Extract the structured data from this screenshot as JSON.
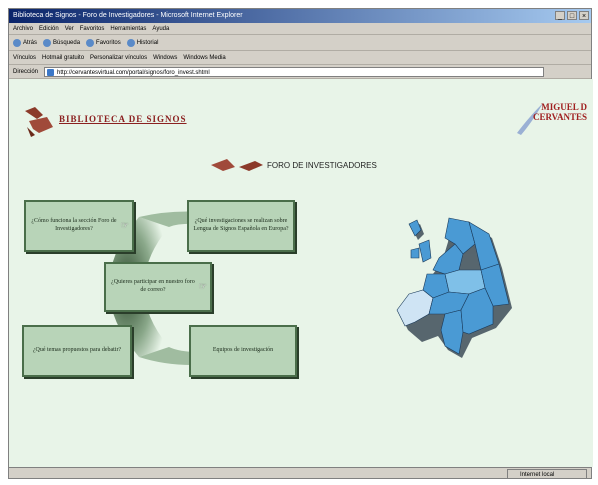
{
  "window": {
    "title": "Biblioteca de Signos - Foro de Investigadores - Microsoft Internet Explorer",
    "controls": [
      "_",
      "□",
      "×"
    ]
  },
  "menubar": {
    "items": [
      "Archivo",
      "Edición",
      "Ver",
      "Favoritos",
      "Herramientas",
      "Ayuda"
    ]
  },
  "toolbar": {
    "buttons": [
      "Atrás",
      "Búsqueda",
      "Favoritos",
      "Historial"
    ]
  },
  "linksbar": {
    "label": "Vínculos",
    "items": [
      "Hotmail gratuito",
      "Personalizar vínculos",
      "Windows",
      "Windows Media"
    ]
  },
  "addressbar": {
    "label": "Dirección",
    "value": "http://cervantesvirtual.com/portal/signos/foro_invest.shtml"
  },
  "page": {
    "site_title": "BIBLIOTECA DE SIGNOS",
    "logo_text_line1": "MIGUEL D",
    "logo_text_line2": "CERVANTES",
    "forum_title": "FORO DE INVESTIGADORES",
    "boxes": [
      {
        "text": "¿Cómo funciona la sección Foro de Investigadores?"
      },
      {
        "text": "¿Qué investigaciones se realizan sobre Lengua de Signos Española en Europa?"
      },
      {
        "text": "¿Quieres participar en nuestro foro de correo?"
      },
      {
        "text": "¿Qué temas propuestos para debatir?"
      },
      {
        "text": "Equipos de investigación"
      }
    ]
  },
  "statusbar": {
    "left": "",
    "zone": "Internet local"
  },
  "colors": {
    "background": "#e8f4e8",
    "box": "#b8d4b8",
    "map_blue": "#4a9ad4"
  }
}
